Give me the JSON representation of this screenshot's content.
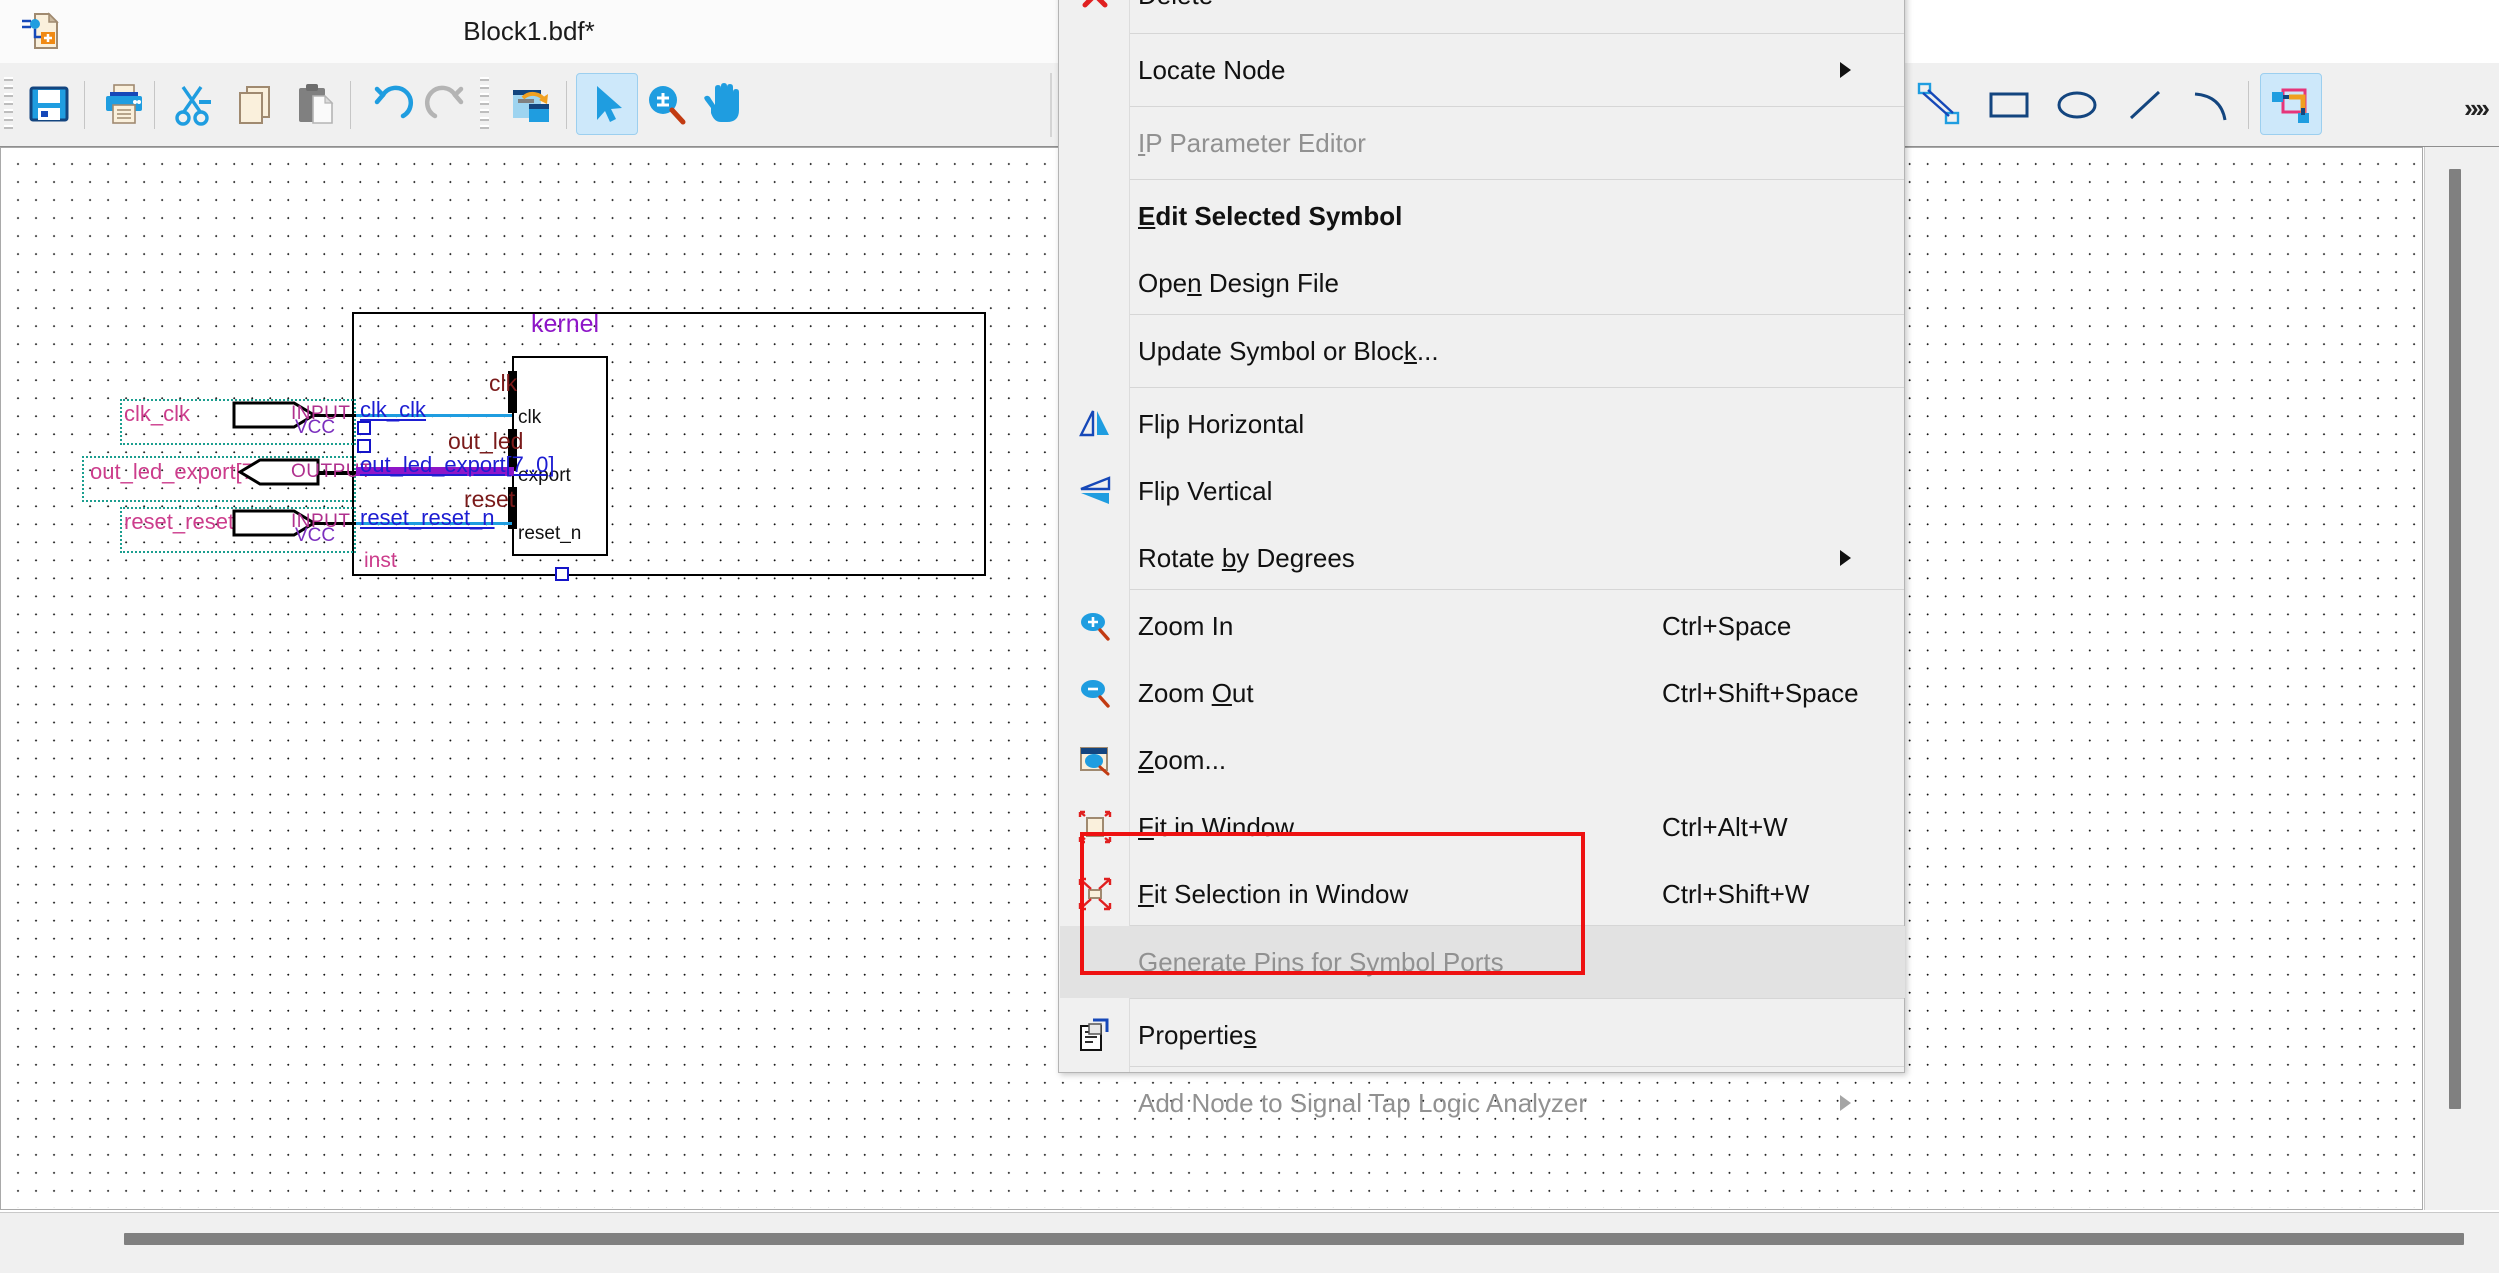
{
  "window": {
    "title": "Block1.bdf*",
    "icon": "block-diagram-file-icon"
  },
  "toolbar": {
    "buttons": [
      {
        "name": "save-button",
        "icon": "floppy-disk-icon",
        "label": "Save",
        "active": false
      },
      {
        "name": "print-button",
        "icon": "printer-icon",
        "label": "Print",
        "active": false
      },
      {
        "name": "cut-button",
        "icon": "scissors-icon",
        "label": "Cut",
        "active": false
      },
      {
        "name": "copy-button",
        "icon": "copy-pages-icon",
        "label": "Copy",
        "active": false
      },
      {
        "name": "paste-button",
        "icon": "clipboard-paste-icon",
        "label": "Paste",
        "active": false
      },
      {
        "name": "undo-button",
        "icon": "undo-arrow-icon",
        "label": "Undo",
        "active": false
      },
      {
        "name": "redo-button",
        "icon": "redo-arrow-icon",
        "label": "Redo",
        "active": false
      },
      {
        "name": "find-replace-button",
        "icon": "window-swap-icon",
        "label": "Find/Replace",
        "active": false
      },
      {
        "name": "select-tool-button",
        "icon": "arrow-cursor-icon",
        "label": "Selection Tool",
        "active": true
      },
      {
        "name": "zoom-tool-button",
        "icon": "magnifier-plusminus-icon",
        "label": "Zoom Tool",
        "active": false
      },
      {
        "name": "hand-tool-button",
        "icon": "hand-icon",
        "label": "Hand Tool",
        "active": false
      },
      {
        "name": "orthogonal-node-tool-button",
        "icon": "orthogonal-node-line-icon",
        "label": "Orthogonal Node Tool",
        "active": false
      },
      {
        "name": "rectangle-tool-button",
        "icon": "rectangle-icon",
        "label": "Rectangle Tool",
        "active": false
      },
      {
        "name": "ellipse-tool-button",
        "icon": "ellipse-icon",
        "label": "Ellipse Tool",
        "active": false
      },
      {
        "name": "line-tool-button",
        "icon": "line-icon",
        "label": "Line Tool",
        "active": false
      },
      {
        "name": "arc-tool-button",
        "icon": "arc-icon",
        "label": "Arc Tool",
        "active": false
      },
      {
        "name": "rubberbanding-button",
        "icon": "rubberbanding-icon",
        "label": "Rubberbanding",
        "active": true
      }
    ],
    "overflow_label": "»»"
  },
  "context_menu": {
    "items": [
      {
        "label": "Delete",
        "icon": "delete-x-icon",
        "accel": "",
        "disabled": false,
        "bold": false,
        "submenu": false,
        "highlighted": false,
        "truncated": true
      },
      {
        "label": "Locate Node",
        "icon": "",
        "accel": "",
        "disabled": false,
        "bold": false,
        "submenu": true,
        "highlighted": false
      },
      {
        "label": "IP Parameter Editor",
        "icon": "",
        "accel": "",
        "disabled": true,
        "bold": false,
        "submenu": false,
        "highlighted": false,
        "mnemonic": "I"
      },
      {
        "label": "Edit Selected Symbol",
        "icon": "",
        "accel": "",
        "disabled": false,
        "bold": true,
        "submenu": false,
        "highlighted": false,
        "mnemonic": "E"
      },
      {
        "label": "Open Design File",
        "icon": "",
        "accel": "",
        "disabled": false,
        "bold": false,
        "submenu": false,
        "highlighted": false
      },
      {
        "label": "Update Symbol or Block...",
        "icon": "",
        "accel": "",
        "disabled": false,
        "bold": false,
        "submenu": false,
        "highlighted": false
      },
      {
        "label": "Flip Horizontal",
        "icon": "flip-horizontal-icon",
        "accel": "",
        "disabled": false,
        "bold": false,
        "submenu": false,
        "highlighted": false
      },
      {
        "label": "Flip Vertical",
        "icon": "flip-vertical-icon",
        "accel": "",
        "disabled": false,
        "bold": false,
        "submenu": false,
        "highlighted": false
      },
      {
        "label": "Rotate by Degrees",
        "icon": "",
        "accel": "",
        "disabled": false,
        "bold": false,
        "submenu": true,
        "highlighted": false
      },
      {
        "label": "Zoom In",
        "icon": "zoom-in-icon",
        "accel": "Ctrl+Space",
        "disabled": false,
        "bold": false,
        "submenu": false,
        "highlighted": false
      },
      {
        "label": "Zoom Out",
        "icon": "zoom-out-icon",
        "accel": "Ctrl+Shift+Space",
        "disabled": false,
        "bold": false,
        "submenu": false,
        "highlighted": false
      },
      {
        "label": "Zoom...",
        "icon": "zoom-dialog-icon",
        "accel": "",
        "disabled": false,
        "bold": false,
        "submenu": false,
        "highlighted": false
      },
      {
        "label": "Fit in Window",
        "icon": "fit-in-window-icon",
        "accel": "Ctrl+Alt+W",
        "disabled": false,
        "bold": false,
        "submenu": false,
        "highlighted": false
      },
      {
        "label": "Fit Selection in Window",
        "icon": "fit-selection-icon",
        "accel": "Ctrl+Shift+W",
        "disabled": false,
        "bold": false,
        "submenu": false,
        "highlighted": false
      },
      {
        "label": "Generate Pins for Symbol Ports",
        "icon": "",
        "accel": "",
        "disabled": true,
        "bold": false,
        "submenu": false,
        "highlighted": true
      },
      {
        "label": "Properties",
        "icon": "properties-icon",
        "accel": "",
        "disabled": false,
        "bold": false,
        "submenu": false,
        "highlighted": false
      },
      {
        "label": "Add Node to Signal Tap Logic Analyzer",
        "icon": "",
        "accel": "",
        "disabled": true,
        "bold": false,
        "submenu": true,
        "highlighted": false
      }
    ]
  },
  "annotation": {
    "name": "red-highlight-rectangle",
    "color": "#ee1111"
  },
  "schematic": {
    "block_name": "kernel",
    "instance_name": "inst",
    "symbol_ports": [
      {
        "port": "clk",
        "net": "clk"
      },
      {
        "port": "export",
        "net": "out_led"
      },
      {
        "port": "reset_n",
        "net": "reset"
      }
    ],
    "pins": [
      {
        "name": "clk_clk",
        "type": "INPUT",
        "default": "VCC",
        "net": "clk_clk",
        "bus": false
      },
      {
        "name": "out_led_export[7..0]",
        "type": "OUTPUT",
        "default": "",
        "net": "out_led_export[7..0]",
        "bus": true
      },
      {
        "name": "reset_reset_n",
        "type": "INPUT",
        "default": "VCC",
        "net": "reset_reset_n",
        "bus": false
      }
    ]
  }
}
